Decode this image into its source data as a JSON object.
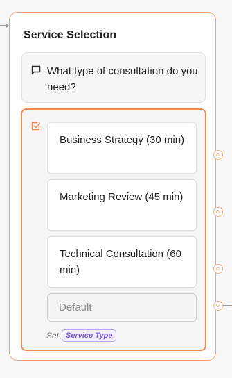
{
  "node": {
    "title": "Service Selection",
    "accent_color": "#f08b57",
    "border_color": "#f0a27a",
    "question": {
      "icon": "message-square-icon",
      "text": "What type of consultation do you need?"
    },
    "choices": {
      "icon": "checkbox-checked-icon",
      "options": [
        {
          "label": "Business Strategy (30 min)"
        },
        {
          "label": "Marketing Review (45 min)"
        },
        {
          "label": "Technical Consultation (60 min)"
        }
      ],
      "default_placeholder": "Default",
      "set_label": "Set",
      "variable": "Service Type",
      "variable_color": "#7c5ce0"
    }
  }
}
